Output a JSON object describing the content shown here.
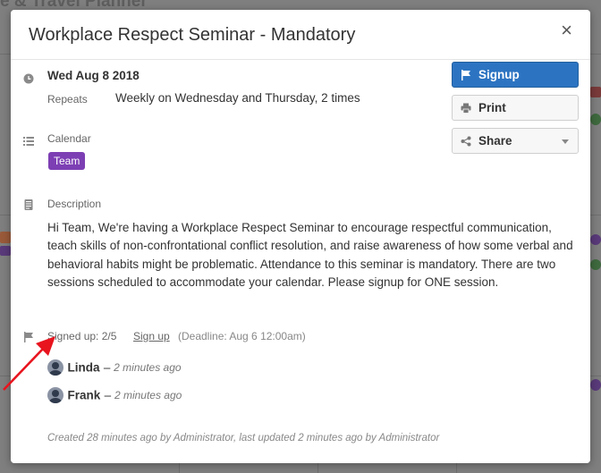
{
  "background": {
    "title_fragment": "e & Travel Planner"
  },
  "modal": {
    "title": "Workplace Respect Seminar - Mandatory",
    "close_glyph": "×",
    "date": "Wed Aug 8 2018",
    "repeats_label": "Repeats",
    "repeats_value": "Weekly on Wednesday and Thursday, 2 times",
    "calendar_label": "Calendar",
    "calendar_badge": "Team",
    "calendar_badge_color": "#7d3fb4",
    "description_label": "Description",
    "description": "Hi Team, We're having a Workplace Respect Seminar to encourage respectful communication, teach skills of non-confrontational conflict resolution, and raise awareness of how some verbal and behavioral habits might be problematic. Attendance to this seminar is mandatory. There are two sessions scheduled to accommodate your calendar. Please signup for ONE session.",
    "signed_up": "Signed up: 2/5",
    "signup_link": "Sign up",
    "deadline": "(Deadline: Aug 6 12:00am)",
    "attendees": [
      {
        "name": "Linda",
        "separator": "–",
        "time": "2 minutes ago"
      },
      {
        "name": "Frank",
        "separator": "–",
        "time": "2 minutes ago"
      }
    ],
    "footer": "Created 28 minutes ago by Administrator, last updated 2 minutes ago by Administrator"
  },
  "actions": {
    "signup_label": "Signup",
    "print_label": "Print",
    "share_label": "Share",
    "primary_color": "#2c74c2"
  },
  "icons": {
    "clock": "clock-icon",
    "calendar_list": "list-icon",
    "description": "document-icon",
    "signup": "flag-icon",
    "print": "printer-icon",
    "share": "share-icon",
    "annotation": "red-arrow"
  }
}
